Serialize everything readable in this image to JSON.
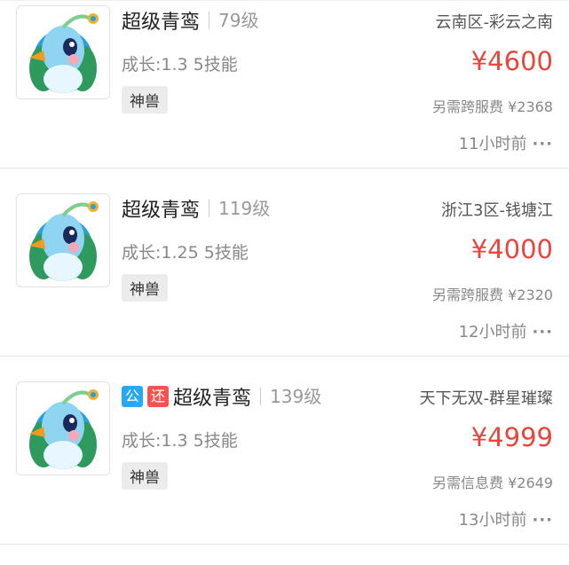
{
  "listings": [
    {
      "badges": [],
      "name": "超级青鸾",
      "level": "79级",
      "growth": "成长:1.3 5技能",
      "tag": "神兽",
      "server": "云南区-彩云之南",
      "price": "¥4600",
      "fee": "另需跨服费 ¥2368",
      "time": "11小时前"
    },
    {
      "badges": [],
      "name": "超级青鸾",
      "level": "119级",
      "growth": "成长:1.25 5技能",
      "tag": "神兽",
      "server": "浙江3区-钱塘江",
      "price": "¥4000",
      "fee": "另需跨服费 ¥2320",
      "time": "12小时前"
    },
    {
      "badges": [
        "公",
        "还"
      ],
      "name": "超级青鸾",
      "level": "139级",
      "growth": "成长:1.3 5技能",
      "tag": "神兽",
      "server": "天下无双-群星璀璨",
      "price": "¥4999",
      "fee": "另需信息费 ¥2649",
      "time": "13小时前"
    }
  ],
  "colors": {
    "price": "#e8453c",
    "badge_gong": "#2aa7f3",
    "badge_huan": "#f2544e"
  },
  "icons": {
    "thumbnail": "qingluan-bird-icon",
    "more": "more-dots-icon"
  }
}
